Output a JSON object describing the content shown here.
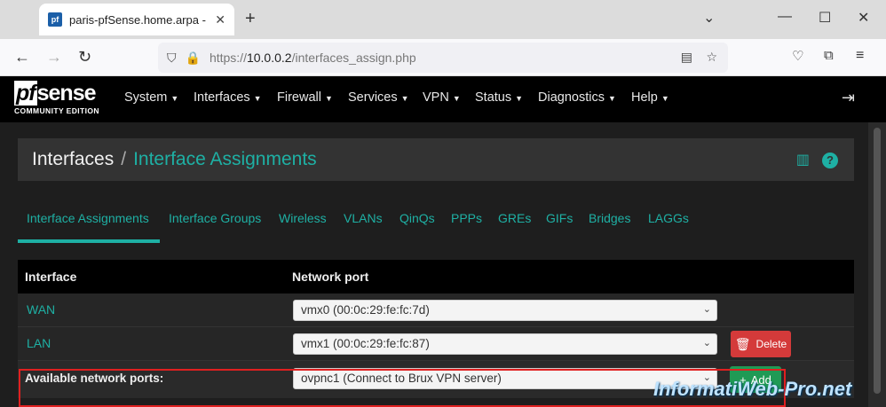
{
  "browser": {
    "tab_title": "paris-pfSense.home.arpa - Inter",
    "favicon_text": "pf",
    "url_scheme": "https://",
    "url_host": "10.0.0.2",
    "url_path": "/interfaces_assign.php"
  },
  "brand": {
    "main": "sense",
    "pf": "pf",
    "edition": "COMMUNITY EDITION"
  },
  "menu": {
    "items": [
      {
        "label": "System"
      },
      {
        "label": "Interfaces"
      },
      {
        "label": "Firewall"
      },
      {
        "label": "Services"
      },
      {
        "label": "VPN"
      },
      {
        "label": "Status"
      },
      {
        "label": "Diagnostics"
      },
      {
        "label": "Help"
      }
    ]
  },
  "breadcrumb": {
    "parent": "Interfaces",
    "separator": "/",
    "current": "Interface Assignments"
  },
  "tabs": [
    {
      "label": "Interface Assignments",
      "active": true
    },
    {
      "label": "Interface Groups"
    },
    {
      "label": "Wireless"
    },
    {
      "label": "VLANs"
    },
    {
      "label": "QinQs"
    },
    {
      "label": "PPPs"
    },
    {
      "label": "GREs"
    },
    {
      "label": "GIFs"
    },
    {
      "label": "Bridges"
    },
    {
      "label": "LAGGs"
    }
  ],
  "table": {
    "headers": {
      "interface": "Interface",
      "port": "Network port"
    },
    "rows": [
      {
        "name": "WAN",
        "port": "vmx0 (00:0c:29:fe:fc:7d)"
      },
      {
        "name": "LAN",
        "port": "vmx1 (00:0c:29:fe:fc:87)",
        "action": "Delete"
      }
    ],
    "available": {
      "label": "Available network ports:",
      "port": "ovpnc1 (Connect to Brux VPN server)",
      "action": "Add"
    }
  },
  "watermark": "InformatiWeb-Pro.net",
  "colors": {
    "accent": "#1eb0a4",
    "danger": "#d43a3a",
    "success": "#1f9a55",
    "highlight": "#e02020"
  }
}
